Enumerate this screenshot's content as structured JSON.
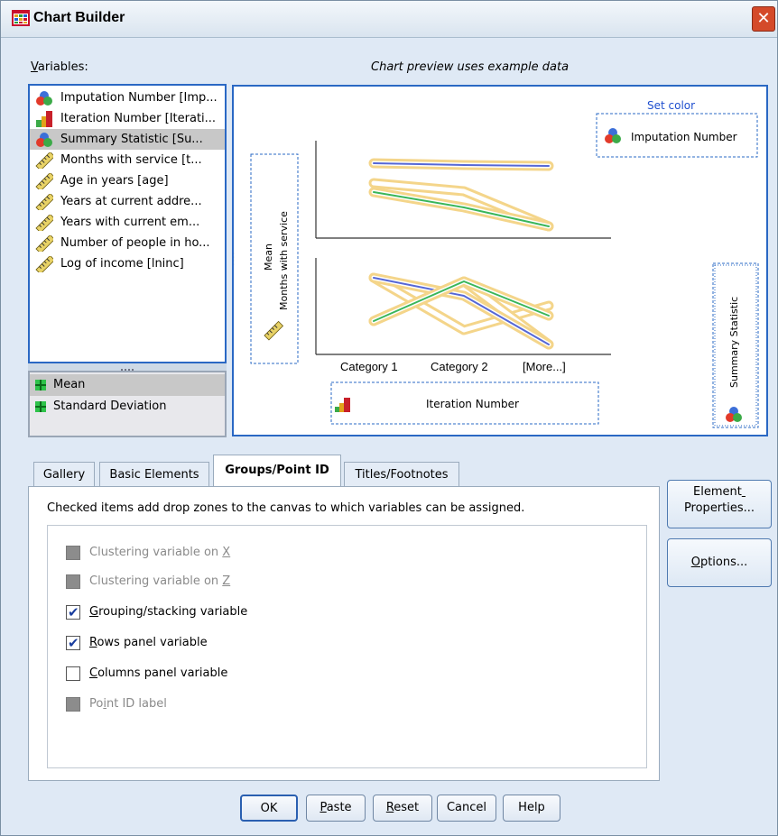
{
  "window": {
    "title": "Chart Builder",
    "close": "✕"
  },
  "variables_label": "Variables:",
  "preview_label": "Chart preview uses example data",
  "variables": [
    {
      "label": "Imputation Number [Imp...",
      "icon": "nominal-icon",
      "selected": false
    },
    {
      "label": "Iteration Number [Iterati...",
      "icon": "ordinal-icon",
      "selected": false
    },
    {
      "label": "Summary Statistic [Su...",
      "icon": "nominal-icon",
      "selected": true
    },
    {
      "label": "Months with service [t...",
      "icon": "scale-icon",
      "selected": false
    },
    {
      "label": "Age in years [age]",
      "icon": "scale-icon",
      "selected": false
    },
    {
      "label": "Years at current addre...",
      "icon": "scale-icon",
      "selected": false
    },
    {
      "label": "Years with current em...",
      "icon": "scale-icon",
      "selected": false
    },
    {
      "label": "Number of people in ho...",
      "icon": "scale-icon",
      "selected": false
    },
    {
      "label": "Log of income  [lninc]",
      "icon": "scale-icon",
      "selected": false
    }
  ],
  "statistics": [
    {
      "label": "Mean",
      "selected": true
    },
    {
      "label": "Standard Deviation",
      "selected": false
    }
  ],
  "canvas": {
    "set_color": "Set color",
    "color_var": "Imputation Number",
    "y_stat": "Mean",
    "y_var": "Months with service",
    "categories": [
      "Category 1",
      "Category 2",
      "[More...]"
    ],
    "x_var": "Iteration Number",
    "panel_var": "Summary Statistic"
  },
  "tabs": [
    {
      "label": "Gallery",
      "active": false
    },
    {
      "label": "Basic Elements",
      "active": false
    },
    {
      "label": "Groups/Point ID",
      "active": true
    },
    {
      "label": "Titles/Footnotes",
      "active": false
    }
  ],
  "panel_desc": "Checked items add drop zones to the canvas to which variables can be assigned.",
  "options": [
    {
      "pre": "Clustering variable on ",
      "key": "X",
      "post": "",
      "checked": false,
      "enabled": false
    },
    {
      "pre": "Clustering variable on ",
      "key": "Z",
      "post": "",
      "checked": false,
      "enabled": false
    },
    {
      "pre": "",
      "key": "G",
      "post": "rouping/stacking variable",
      "checked": true,
      "enabled": true
    },
    {
      "pre": "",
      "key": "R",
      "post": "ows panel variable",
      "checked": true,
      "enabled": true
    },
    {
      "pre": "",
      "key": "C",
      "post": "olumns panel variable",
      "checked": false,
      "enabled": true
    },
    {
      "pre": "Po",
      "key": "i",
      "post": "nt ID label",
      "checked": false,
      "enabled": false
    }
  ],
  "side_buttons": {
    "element_properties": {
      "line1_pre": "Element",
      "line1_key": "",
      "line2": "Properties..."
    },
    "options": {
      "key": "O",
      "rest": "ptions..."
    }
  },
  "buttons": {
    "ok": "OK",
    "paste": {
      "key": "P",
      "rest": "aste"
    },
    "reset": {
      "key": "R",
      "rest": "eset"
    },
    "cancel": "Cancel",
    "help": "Help"
  },
  "colors": {
    "accent_border": "#2a68c4",
    "line_blue": "#5567d6",
    "line_green": "#3ab65a",
    "highlight": "#f4d58a"
  }
}
